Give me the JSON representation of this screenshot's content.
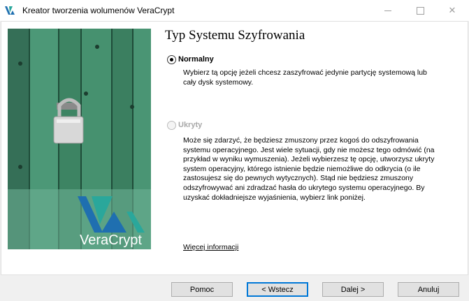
{
  "window": {
    "title": "Kreator tworzenia wolumenów VeraCrypt"
  },
  "branding": {
    "logo_text": "VeraCrypt"
  },
  "page": {
    "heading": "Typ Systemu Szyfrowania",
    "options": [
      {
        "label": "Normalny",
        "selected": true,
        "enabled": true,
        "description": [
          "Wybierz tą opcję jeżeli chcesz zaszyfrować jedynie partycję systemową lub",
          "cały dysk systemowy."
        ]
      },
      {
        "label": "Ukryty",
        "selected": false,
        "enabled": false,
        "description": [
          "Może się zdarzyć, że będziesz zmuszony przez kogoś do odszyfrowania",
          "systemu operacyjnego. Jest wiele sytuacji, gdy nie możesz tego odmówić (na",
          "przykład w wyniku wymuszenia). Jeżeli wybierzesz tę opcję, utworzysz ukryty",
          "system operacyjny, którego istnienie będzie niemożliwe do odkrycia (o ile",
          "zastosujesz się do pewnych wytycznych). Stąd nie będziesz zmuszony",
          "odszyfrowywać ani zdradzać hasła do ukrytego systemu operacyjnego. By",
          "uzyskać dokładniejsze wyjaśnienia, wybierz link poniżej."
        ]
      }
    ],
    "more_info_link": "Więcej informacji"
  },
  "buttons": {
    "help": "Pomoc",
    "back": "< Wstecz",
    "next": "Dalej >",
    "cancel": "Anuluj"
  },
  "colors": {
    "door_green": "#3f8a66",
    "logo_blue": "#1f6fb0",
    "logo_teal": "#2aa79b",
    "default_button_border": "#0078d7"
  }
}
